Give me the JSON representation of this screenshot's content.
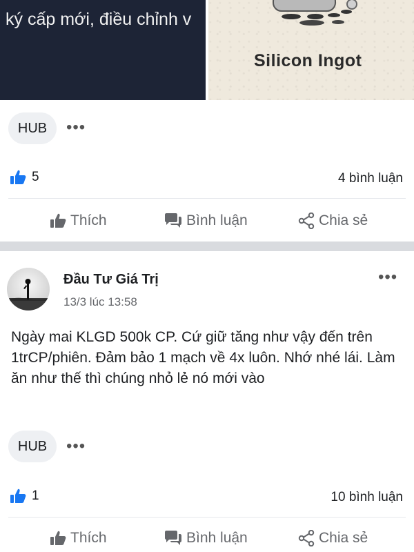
{
  "top_media": {
    "left_caption": "ký cấp mới, điều chỉnh v",
    "right_label": "Silicon Ingot"
  },
  "post1": {
    "tag": "HUB",
    "likes": "5",
    "comments": "4 bình luận"
  },
  "actions": {
    "like": "Thích",
    "comment": "Bình luận",
    "share": "Chia sẻ"
  },
  "post2": {
    "author": "Đầu Tư Giá Trị",
    "time": "13/3 lúc 13:58",
    "text": "Ngày mai KLGD 500k CP. Cứ giữ tăng như vậy đến trên 1trCP/phiên. Đảm bảo 1 mạch về 4x luôn. Nhớ nhé lái. Làm ăn như thế thì chúng nhỏ lẻ nó mới vào",
    "tag": "HUB",
    "likes": "1",
    "comments": "10 bình luận"
  },
  "colors": {
    "like_blue": "#1877f2",
    "action_gray": "#65676b",
    "separator": "#d9dbdf"
  },
  "icons": {
    "like": "thumbs-up-icon",
    "comment": "comment-icon",
    "share": "share-icon",
    "more": "more-dots-icon"
  }
}
